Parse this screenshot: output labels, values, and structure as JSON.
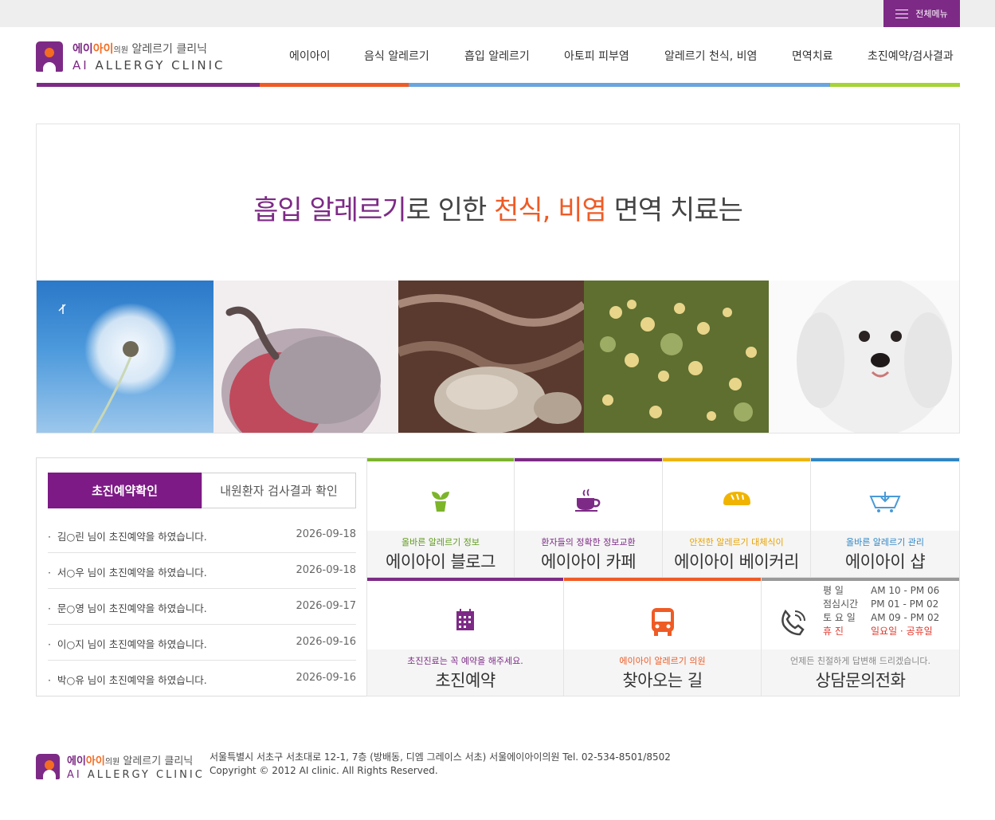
{
  "topbar": {
    "all_menu_label": "전체메뉴"
  },
  "logo": {
    "brand_purple": "에이",
    "brand_orange": "아이",
    "brand_suffix": "의원",
    "brand_tail": " 알레르기 클리닉",
    "line2_ai": "AI",
    "line2_rest": " ALLERGY CLINIC"
  },
  "nav": [
    {
      "label": "에이아이"
    },
    {
      "label": "음식 알레르기"
    },
    {
      "label": "흡입 알레르기"
    },
    {
      "label": "아토피 피부염"
    },
    {
      "label": "알레르기 천식, 비염"
    },
    {
      "label": "면역치료"
    },
    {
      "label": "초진예약/검사결과"
    }
  ],
  "colors": {
    "purple": "#7d2a86",
    "orange": "#ef5b25",
    "blue": "#6aa5e0",
    "lime": "#a6d336",
    "green": "#7cb52a",
    "yellow": "#f0b400",
    "gray": "#9a9a9a"
  },
  "hero": {
    "p1": "흡입 알레르기",
    "p2": "로 인한 ",
    "p3": "천식, 비염",
    "p4": " 면역 치료는",
    "photos": [
      "dandelion-photo",
      "moldy-pepper-photo",
      "dust-mite-photo",
      "pollen-plant-photo",
      "white-dog-photo"
    ]
  },
  "notice": {
    "tab_active": "초진예약확인",
    "tab_inactive": "내원환자 검사결과 확인",
    "items": [
      {
        "text": "김○린 님이 초진예약을 하였습니다.",
        "date": "2026-09-18"
      },
      {
        "text": "서○우 님이 초진예약을 하였습니다.",
        "date": "2026-09-18"
      },
      {
        "text": "문○영 님이 초진예약을 하였습니다.",
        "date": "2026-09-17"
      },
      {
        "text": "이○지 님이 초진예약을 하였습니다.",
        "date": "2026-09-16"
      },
      {
        "text": "박○유 님이 초진예약을 하였습니다.",
        "date": "2026-09-16"
      }
    ]
  },
  "tiles": [
    {
      "sub": "올바른 알레르기 정보",
      "main": "에이아이 블로그",
      "icon": "plant-pot-icon"
    },
    {
      "sub": "환자들의 정확한 정보교환",
      "main": "에이아이 카페",
      "icon": "coffee-cup-icon"
    },
    {
      "sub": "안전한 알레르기 대체식이",
      "main": "에이아이 베이커리",
      "icon": "bread-icon"
    },
    {
      "sub": "올바른 알레르기 관리",
      "main": "에이아이 샵",
      "icon": "shopping-basket-icon"
    }
  ],
  "tiles2": [
    {
      "sub": "초진진료는 꼭 예약을 해주세요.",
      "main": "초진예약",
      "icon": "calendar-icon"
    },
    {
      "sub": "에이아이 알레르기 의원",
      "main": "찾아오는 길",
      "icon": "bus-icon"
    },
    {
      "sub": "언제든 친절하게 답변해 드리겠습니다.",
      "main": "상담문의전화",
      "icon": "phone-icon"
    }
  ],
  "hours": [
    {
      "k": "평 일",
      "v": "AM 10 - PM 06"
    },
    {
      "k": "점심시간",
      "v": "PM 01 - PM 02"
    },
    {
      "k": "토 요 일",
      "v": "AM 09 - PM 02"
    },
    {
      "k": "휴 진",
      "v": "일요일 · 공휴일"
    }
  ],
  "footer": {
    "address": "서울특별시 서초구 서초대로 12-1, 7층 (방배동, 디엠 그레이스 서초) 서울에이아이의원 Tel. 02-534-8501/8502",
    "copyright": "Copyright © 2012 AI clinic. All Rights Reserved."
  }
}
